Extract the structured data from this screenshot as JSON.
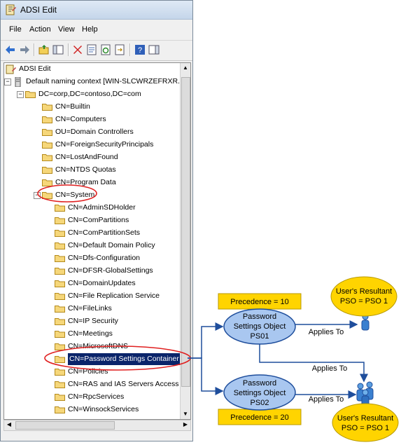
{
  "window": {
    "title": "ADSI Edit",
    "menu": [
      "File",
      "Action",
      "View",
      "Help"
    ]
  },
  "tree": {
    "root": "ADSI Edit",
    "context": "Default naming context [WIN-SLCWRZEFRXR.cor",
    "domain": "DC=corp,DC=contoso,DC=com",
    "level2": [
      "CN=Builtin",
      "CN=Computers",
      "OU=Domain Controllers",
      "CN=ForeignSecurityPrincipals",
      "CN=LostAndFound",
      "CN=NTDS Quotas",
      "CN=Program Data"
    ],
    "system": "CN=System",
    "system_children": [
      "CN=AdminSDHolder",
      "CN=ComPartitions",
      "CN=ComPartitionSets",
      "CN=Default Domain Policy",
      "CN=Dfs-Configuration",
      "CN=DFSR-GlobalSettings",
      "CN=DomainUpdates",
      "CN=File Replication Service",
      "CN=FileLinks",
      "CN=IP Security",
      "CN=Meetings",
      "CN=MicrosoftDNS",
      "CN=Password Settings Container",
      "CN=Policies",
      "CN=RAS and IAS Servers Access Che",
      "CN=RpcServices",
      "CN=WinsockServices"
    ]
  },
  "diagram": {
    "precedence_top": "Precedence = 10",
    "precedence_bottom": "Precedence = 20",
    "pso1": [
      "Password",
      "Settings Object",
      "PS01"
    ],
    "pso2": [
      "Password",
      "Settings Object",
      "PS02"
    ],
    "applies_to": "Applies To",
    "resultant": [
      "User's Resultant",
      "PSO = PSO 1"
    ],
    "colors": {
      "ellipse_blue": "#a9c7f0",
      "ellipse_border": "#1f4e9c",
      "gold": "#ffd400",
      "arrow": "#1f4e9c",
      "highlight": "#e02020",
      "selected": "#0a246a"
    }
  }
}
